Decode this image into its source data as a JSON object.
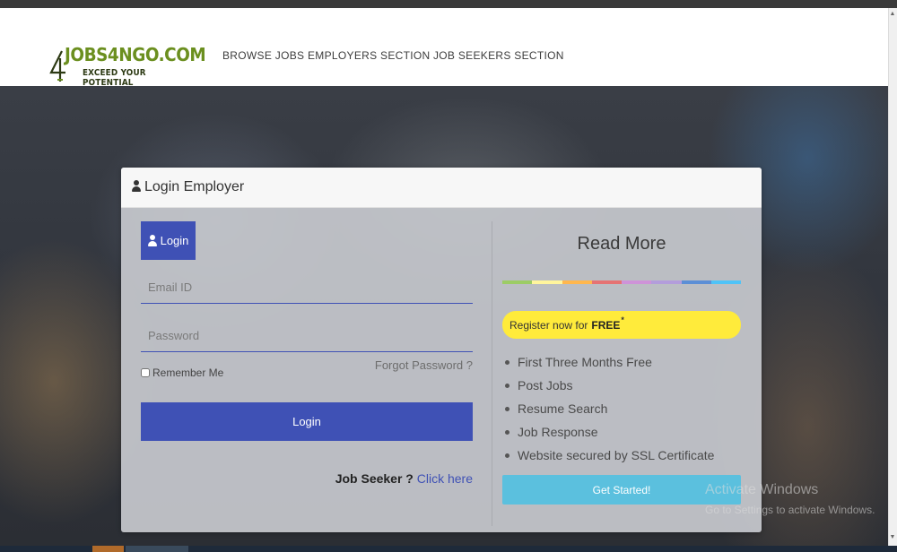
{
  "brand": {
    "logo_text": "JOBS4NGO.COM",
    "tagline": "EXCEED YOUR POTENTIAL",
    "logo_color": "#6b8f1f"
  },
  "nav": {
    "items": [
      {
        "label": "BROWSE JOBS"
      },
      {
        "label": "EMPLOYERS SECTION"
      },
      {
        "label": "JOB SEEKERS SECTION"
      }
    ]
  },
  "card": {
    "title": "Login Employer",
    "title_icon": "user-icon"
  },
  "login_form": {
    "tab_label": "Login",
    "email_placeholder": "Email ID",
    "email_value": "",
    "password_placeholder": "Password",
    "password_value": "",
    "remember_label": "Remember Me",
    "remember_checked": false,
    "forgot_label": "Forgot Password ?",
    "submit_label": "Login",
    "seeker_prefix": "Job Seeker ?",
    "seeker_link": "Click here",
    "accent_color": "#3f51b5"
  },
  "promo": {
    "heading": "Read More",
    "stripe_colors": [
      "#9ccc65",
      "#fff59d",
      "#ffb74d",
      "#e57373",
      "#ce93d8",
      "#b39ddb",
      "#5c8fd6",
      "#4fc3f7"
    ],
    "register_text": "Register now for",
    "register_emphasis": "FREE",
    "register_mark": "*",
    "register_color": "#ffeb3b",
    "benefits": [
      "First Three Months Free",
      "Post Jobs",
      "Resume Search",
      "Job Response",
      "Website secured by SSL Certificate"
    ],
    "cta_label": "Get Started!",
    "cta_color": "#5bc0de"
  },
  "watermark": {
    "title": "Activate Windows",
    "subtitle": "Go to Settings to activate Windows."
  }
}
